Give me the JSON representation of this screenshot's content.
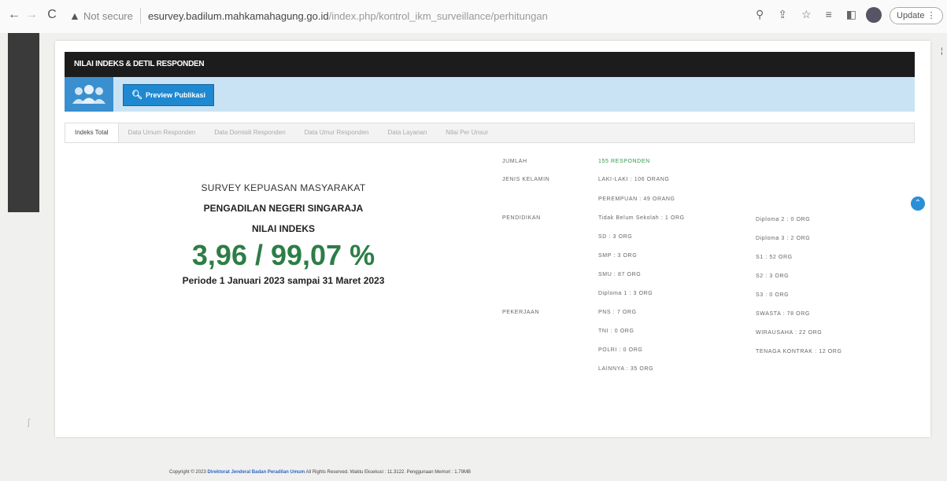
{
  "browser": {
    "not_secure": "Not secure",
    "url_host": "esurvey.badilum.mahkamahagung.go.id",
    "url_path": "/index.php/kontrol_ikm_surveillance/perhitungan",
    "update_label": "Update"
  },
  "header": {
    "title": "NILAI INDEKS & DETIL RESPONDEN",
    "preview_button": "Preview Publikasi"
  },
  "tabs": [
    {
      "label": "Indeks Total"
    },
    {
      "label": "Data Umum Responden"
    },
    {
      "label": "Data Domisili Responden"
    },
    {
      "label": "Data Umur Responden"
    },
    {
      "label": "Data Layanan"
    },
    {
      "label": "Nilai Per Unsur"
    }
  ],
  "index": {
    "survey_title": "SURVEY KEPUASAN MASYARAKAT",
    "court": "PENGADILAN NEGERI SINGARAJA",
    "label": "NILAI INDEKS",
    "value": "3,96 / 99,07 %",
    "period": "Periode 1 Januari 2023 sampai 31 Maret 2023"
  },
  "stats": {
    "jumlah_label": "JUMLAH",
    "jumlah_value": "155 RESPONDEN",
    "gender_label": "JENIS KELAMIN",
    "gender": [
      "LAKI-LAKI : 106 ORANG",
      "PEREMPUAN : 49 ORANG"
    ],
    "pendidikan_label": "PENDIDIKAN",
    "pendidikan_col1": [
      "Tidak Belum Sekolah : 1 ORG",
      "SD : 3 ORG",
      "SMP : 3 ORG",
      "SMU : 87 ORG",
      "Diploma 1 : 3 ORG"
    ],
    "pendidikan_col2": [
      "Diploma 2 : 0 ORG",
      "Diploma 3 : 2 ORG",
      "S1 : 52 ORG",
      "S2 : 3 ORG",
      "S3 : 0 ORG"
    ],
    "pekerjaan_label": "PEKERJAAN",
    "pekerjaan_col1": [
      "PNS : 7 ORG",
      "TNI : 0 ORG",
      "POLRI : 0 ORG",
      "LAINNYA : 35 ORG"
    ],
    "pekerjaan_col2": [
      "SWASTA : 78 ORG",
      "WIRAUSAHA : 22 ORG",
      "TENAGA KONTRAK : 12 ORG"
    ]
  },
  "footer": {
    "copyright": "Copyright © 2023",
    "org": "Direktorat Jenderal Badan Peradilan Umum",
    "rest": "All Rights Reserved. Waktu Eksekusi : 11.3122. Penggunaan Memori : 1.79MB"
  }
}
